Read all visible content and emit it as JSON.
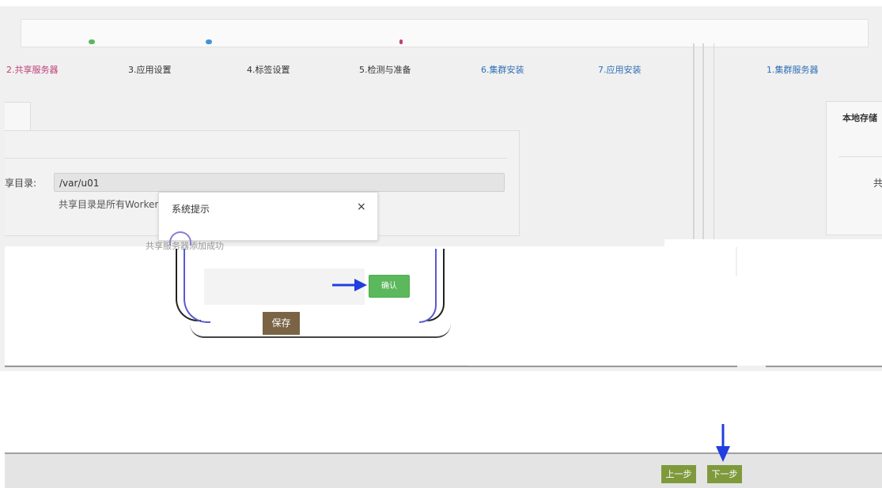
{
  "wizard": {
    "steps": [
      {
        "label": "2.共享服务器",
        "state": "active",
        "color": "#c0407a"
      },
      {
        "label": "3.应用设置",
        "state": "normal"
      },
      {
        "label": "4.标签设置",
        "state": "normal"
      },
      {
        "label": "5.检测与准备",
        "state": "normal"
      },
      {
        "label": "6.集群安装",
        "state": "highlight",
        "color": "#2f6fb5"
      },
      {
        "label": "7.应用安装",
        "state": "highlight",
        "color": "#2f6fb5"
      },
      {
        "label": "1.集群服务器",
        "state": "highlight",
        "color": "#2f6fb5"
      }
    ]
  },
  "form": {
    "share_dir_label": "享目录:",
    "share_dir_value": "/var/u01",
    "share_dir_hint": "共享目录是所有Worker上"
  },
  "right_panel": {
    "tab_label": "本地存储",
    "field_label": "共"
  },
  "dialog": {
    "title": "系统提示",
    "close_glyph": "×",
    "message": "共享服务器添加成功",
    "confirm_label": "确认"
  },
  "save_label": "保存",
  "footer": {
    "prev_label": "上一步",
    "next_label": "下一步"
  },
  "colors": {
    "active_step": "#c0407a",
    "confirm_button": "#5cb85c",
    "nav_button": "#7f9a3c",
    "arrow": "#1f3fe0",
    "save_button": "#7a6445"
  }
}
